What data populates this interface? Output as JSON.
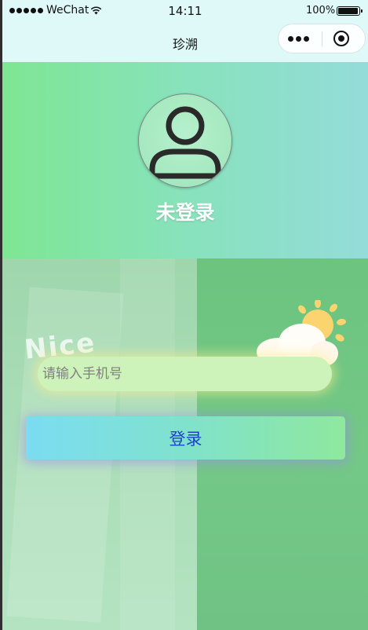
{
  "status_bar": {
    "carrier": "WeChat",
    "time": "14:11",
    "battery_percent": "100%",
    "icons": [
      "signal-dots-icon",
      "wifi-icon",
      "battery-icon"
    ]
  },
  "nav": {
    "title": "珍溯",
    "capsule_icons": [
      "more-dots-icon",
      "close-target-icon"
    ]
  },
  "profile": {
    "avatar_icon": "user-avatar-icon",
    "status_text": "未登录"
  },
  "background": {
    "doodle_text": "Nice",
    "icons": [
      "sun-icon",
      "cloud-icon"
    ]
  },
  "form": {
    "phone_placeholder": "请输入手机号",
    "phone_value": "",
    "login_label": "登录"
  },
  "colors": {
    "header_gradient": [
      "#7ee693",
      "#94dcd9"
    ],
    "button_gradient": [
      "#7bdcf2",
      "#8ee89e"
    ],
    "button_text": "#1d43c9",
    "input_background": "#cdf3bb"
  }
}
